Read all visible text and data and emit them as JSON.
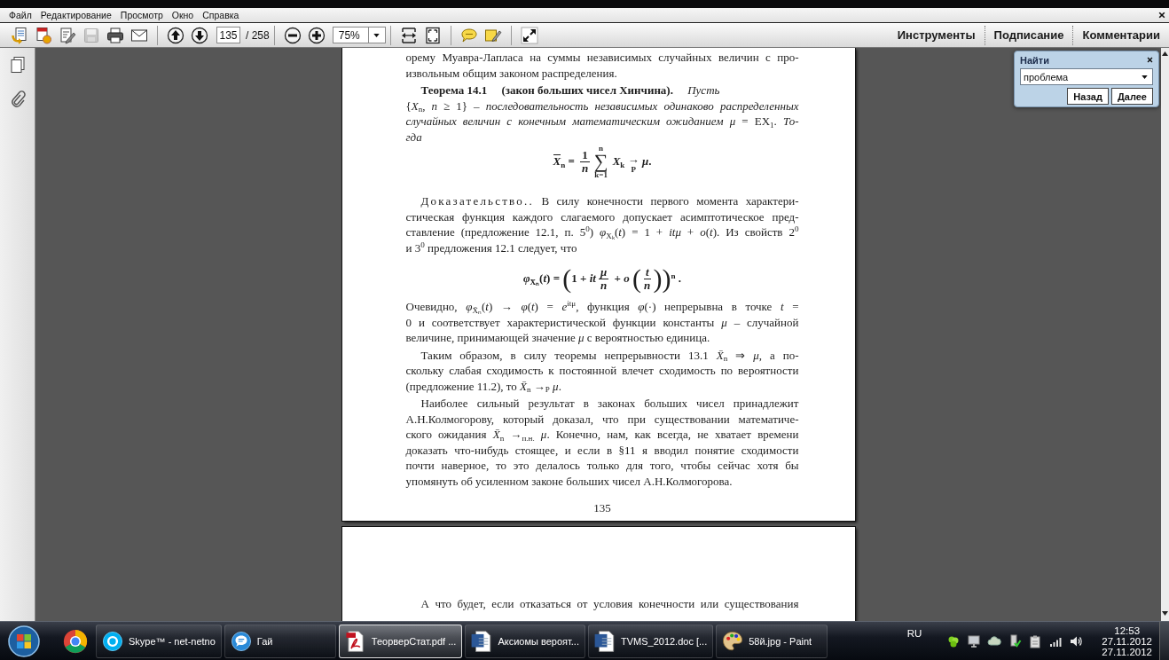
{
  "menu": [
    "Файл",
    "Редактирование",
    "Просмотр",
    "Окно",
    "Справка"
  ],
  "toolbar": {
    "items": [
      {
        "kind": "button",
        "disabled": false
      },
      {
        "kind": "button",
        "disabled": false
      },
      {
        "kind": "button",
        "disabled": false
      },
      {
        "kind": "button",
        "disabled": true
      },
      {
        "kind": "button",
        "disabled": false
      },
      {
        "kind": "button",
        "disabled": false
      },
      {
        "kind": "separator"
      },
      {
        "kind": "button",
        "disabled": false
      },
      {
        "kind": "button",
        "disabled": false
      },
      {
        "kind": "page-field",
        "value": "135"
      },
      {
        "kind": "label",
        "text": "/ 258"
      },
      {
        "kind": "separator"
      },
      {
        "kind": "button",
        "disabled": false
      },
      {
        "kind": "button",
        "disabled": false
      },
      {
        "kind": "zoom-field",
        "value": "75%"
      },
      {
        "kind": "separator"
      },
      {
        "kind": "button",
        "disabled": false
      },
      {
        "kind": "button",
        "disabled": false
      },
      {
        "kind": "separator"
      },
      {
        "kind": "button",
        "disabled": false
      },
      {
        "kind": "button",
        "disabled": false
      },
      {
        "kind": "separator"
      },
      {
        "kind": "button",
        "disabled": false
      }
    ],
    "panes": [
      "Инструменты",
      "Подписание",
      "Комментарии"
    ]
  },
  "find_panel": {
    "title": "Найти",
    "value": "проблема",
    "buttons": [
      "Назад",
      "Далее"
    ]
  },
  "document": {
    "pages": [
      {
        "blocks": [
          {
            "kind": "paragraph",
            "indent": false,
            "lines": [
              "орему Муавра-Лапласа на суммы независимых случайных величин с про-",
              "извольным общим законом распределения."
            ]
          },
          {
            "kind": "theorem",
            "indent": true,
            "head": "**Теорема 14.1**     **(закон больших чисел Хинчина).**     *Пусть*",
            "lines": [
              "{*X*$_{n}$, *n* ≥ 1} – *последовательность независимых одинаково распределенных*",
              "*случайных величин с конечным математическим ожиданием μ* = EX$_{1}$. *То-*",
              "*гда*"
            ]
          },
          {
            "kind": "formula",
            "parts": [
              {
                "kind": "overline",
                "base": "X",
                "sub": "n"
              },
              {
                "kind": "text",
                "text": " = "
              },
              {
                "kind": "frac",
                "num": "1",
                "den": "*n*"
              },
              {
                "kind": "sum",
                "sign": "∑",
                "top": "n",
                "bottom": "k=1"
              },
              {
                "kind": "text",
                "text": " *X*$_{k}$ "
              },
              {
                "kind": "arrow",
                "sign": "→",
                "under": "P"
              },
              {
                "kind": "text",
                "text": " *μ*."
              }
            ]
          },
          {
            "kind": "paragraph",
            "indent": true,
            "lead": "Доказательство..",
            "lines": [
              " В силу конечности первого момента характери-",
              "стическая функция каждого слагаемого допускает асимптотическое пред-",
              "ставление (предложение 12.1, п. 5$^{0}$) *φ*$_{Xₖ}$(*t*) = 1 + *itμ* + *o*(*t*). Из свойств 2$^{0}$",
              "и 3$^{0}$ предложения 12.1 следует, что"
            ]
          },
          {
            "kind": "formula",
            "parts": [
              {
                "kind": "text",
                "text": "*φ*$_{X̄ₙ}$(*t*) = "
              },
              {
                "kind": "delim",
                "sign": "("
              },
              {
                "kind": "text",
                "text": "1 + *it*"
              },
              {
                "kind": "frac",
                "num": "*μ*",
                "den": "*n*"
              },
              {
                "kind": "text",
                "text": " + *o* "
              },
              {
                "kind": "delim",
                "sign": "("
              },
              {
                "kind": "frac",
                "num": "*t*",
                "den": "*n*"
              },
              {
                "kind": "delim",
                "sign": ")"
              },
              {
                "kind": "delim",
                "sign": ")"
              },
              {
                "kind": "text",
                "text": "$^{n}$ ."
              }
            ]
          },
          {
            "kind": "paragraph",
            "indent": false,
            "lines": [
              "Очевидно, *φ*$_{X̄ₙ}$(*t*) → *φ*(*t*) = *e*$^{itμ}$, функция *φ*(·) непрерывна в точке *t* =",
              "0 и соответствует характеристической функции константы *μ* – случайной",
              "величине, принимающей значение *μ* с вероятностью единица."
            ]
          },
          {
            "kind": "paragraph",
            "indent": true,
            "lines": [
              "Таким образом, в силу теоремы непрерывности 13.1 *X̄*$_{n}$ ⇒ *μ*, а по-",
              "скольку слабая сходимость к постоянной влечет сходимость по вероятности",
              "(предложение 11.2), то *X̄*$_{n}$ →$_{P}$ *μ*."
            ]
          },
          {
            "kind": "paragraph",
            "indent": true,
            "lines": [
              "Наиболее сильный результат в законах больших чисел принадлежит",
              "А.Н.Колмогорову, который доказал, что при существовании математиче-",
              "ского ожидания *X̄*$_{n}$ →$_{п.н.}$ *μ*. Конечно, нам, как всегда, не хватает времени",
              "доказать что-нибудь стоящее, и если в §11 я вводил понятие сходимости",
              "почти наверное, то это делалось только для того, чтобы сейчас хотя бы",
              "упомянуть об усиленном законе больших чисел А.Н.Колмогорова."
            ]
          }
        ],
        "page_number": "135"
      },
      {
        "blocks": [
          {
            "kind": "paragraph",
            "indent": true,
            "continues": true,
            "lines": [
              "А что будет, если отказаться от условия конечности или существования"
            ]
          }
        ]
      }
    ]
  },
  "taskbar": {
    "items": [
      {
        "label": "Skype™ - net-netno",
        "selected": false
      },
      {
        "label": "Гай",
        "selected": false
      },
      {
        "label": "ТеорверСтат.pdf ...",
        "selected": true
      },
      {
        "label": "Аксиомы вероят...",
        "selected": false
      },
      {
        "label": "TVMS_2012.doc [...",
        "selected": false
      },
      {
        "label": "58й.jpg - Paint",
        "selected": false
      }
    ],
    "language": "RU",
    "time": "12:53",
    "dates": [
      "27.11.2012",
      "27.11.2012"
    ]
  }
}
